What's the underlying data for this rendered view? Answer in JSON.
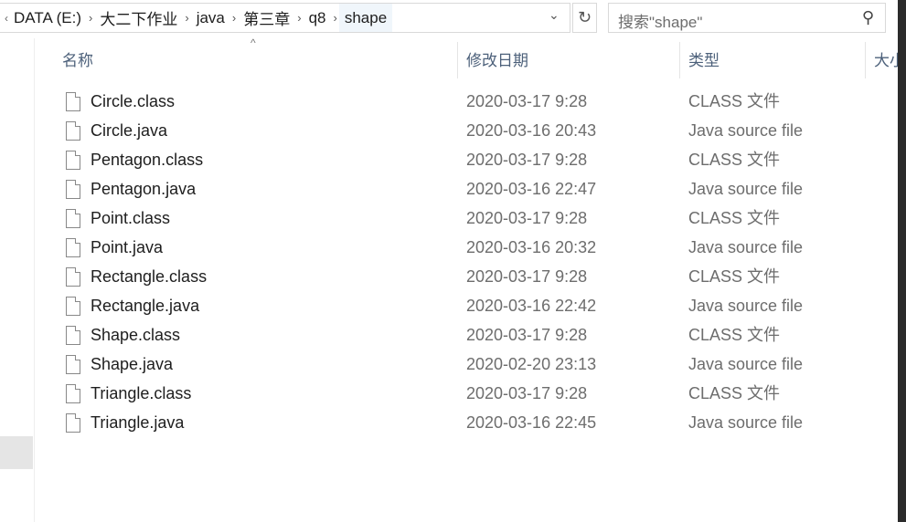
{
  "address": {
    "crumbs": [
      "DATA (E:)",
      "大二下作业",
      "java",
      "第三章",
      "q8",
      "shape"
    ]
  },
  "search": {
    "placeholder": "搜索\"shape\""
  },
  "columns": {
    "name": "名称",
    "date": "修改日期",
    "type": "类型",
    "size": "大小"
  },
  "files": [
    {
      "name": "Circle.class",
      "date": "2020-03-17 9:28",
      "type": "CLASS 文件"
    },
    {
      "name": "Circle.java",
      "date": "2020-03-16 20:43",
      "type": "Java source file"
    },
    {
      "name": "Pentagon.class",
      "date": "2020-03-17 9:28",
      "type": "CLASS 文件"
    },
    {
      "name": "Pentagon.java",
      "date": "2020-03-16 22:47",
      "type": "Java source file"
    },
    {
      "name": "Point.class",
      "date": "2020-03-17 9:28",
      "type": "CLASS 文件"
    },
    {
      "name": "Point.java",
      "date": "2020-03-16 20:32",
      "type": "Java source file"
    },
    {
      "name": "Rectangle.class",
      "date": "2020-03-17 9:28",
      "type": "CLASS 文件"
    },
    {
      "name": "Rectangle.java",
      "date": "2020-03-16 22:42",
      "type": "Java source file"
    },
    {
      "name": "Shape.class",
      "date": "2020-03-17 9:28",
      "type": "CLASS 文件"
    },
    {
      "name": "Shape.java",
      "date": "2020-02-20 23:13",
      "type": "Java source file"
    },
    {
      "name": "Triangle.class",
      "date": "2020-03-17 9:28",
      "type": "CLASS 文件"
    },
    {
      "name": "Triangle.java",
      "date": "2020-03-16 22:45",
      "type": "Java source file"
    }
  ]
}
